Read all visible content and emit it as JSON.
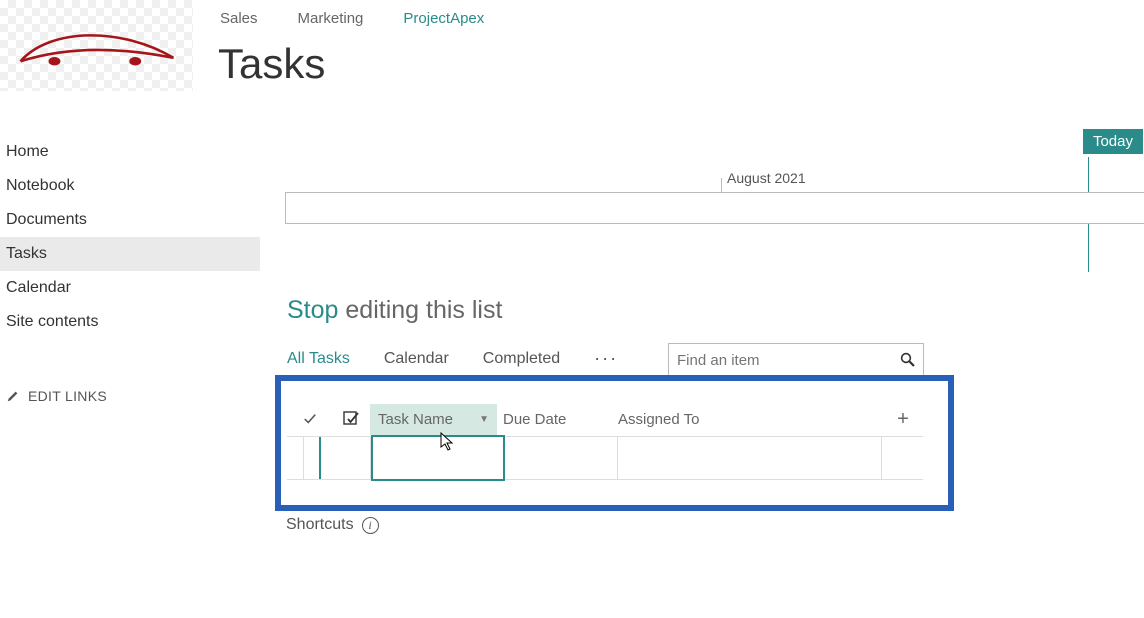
{
  "top_nav": {
    "sales": "Sales",
    "marketing": "Marketing",
    "project": "ProjectApex"
  },
  "page_title": "Tasks",
  "side_nav": {
    "items": [
      {
        "label": "Home"
      },
      {
        "label": "Notebook"
      },
      {
        "label": "Documents"
      },
      {
        "label": "Tasks"
      },
      {
        "label": "Calendar"
      },
      {
        "label": "Site contents"
      }
    ]
  },
  "edit_links": "EDIT LINKS",
  "timeline": {
    "month": "August 2021",
    "today": "Today"
  },
  "edit_bar": {
    "stop": "Stop",
    "rest": " editing this list"
  },
  "view_tabs": {
    "all": "All Tasks",
    "calendar": "Calendar",
    "completed": "Completed",
    "more": "···"
  },
  "search": {
    "placeholder": "Find an item"
  },
  "grid": {
    "headers": {
      "task_name": "Task Name",
      "due_date": "Due Date",
      "assigned_to": "Assigned To",
      "add": "+"
    }
  },
  "shortcuts": "Shortcuts"
}
